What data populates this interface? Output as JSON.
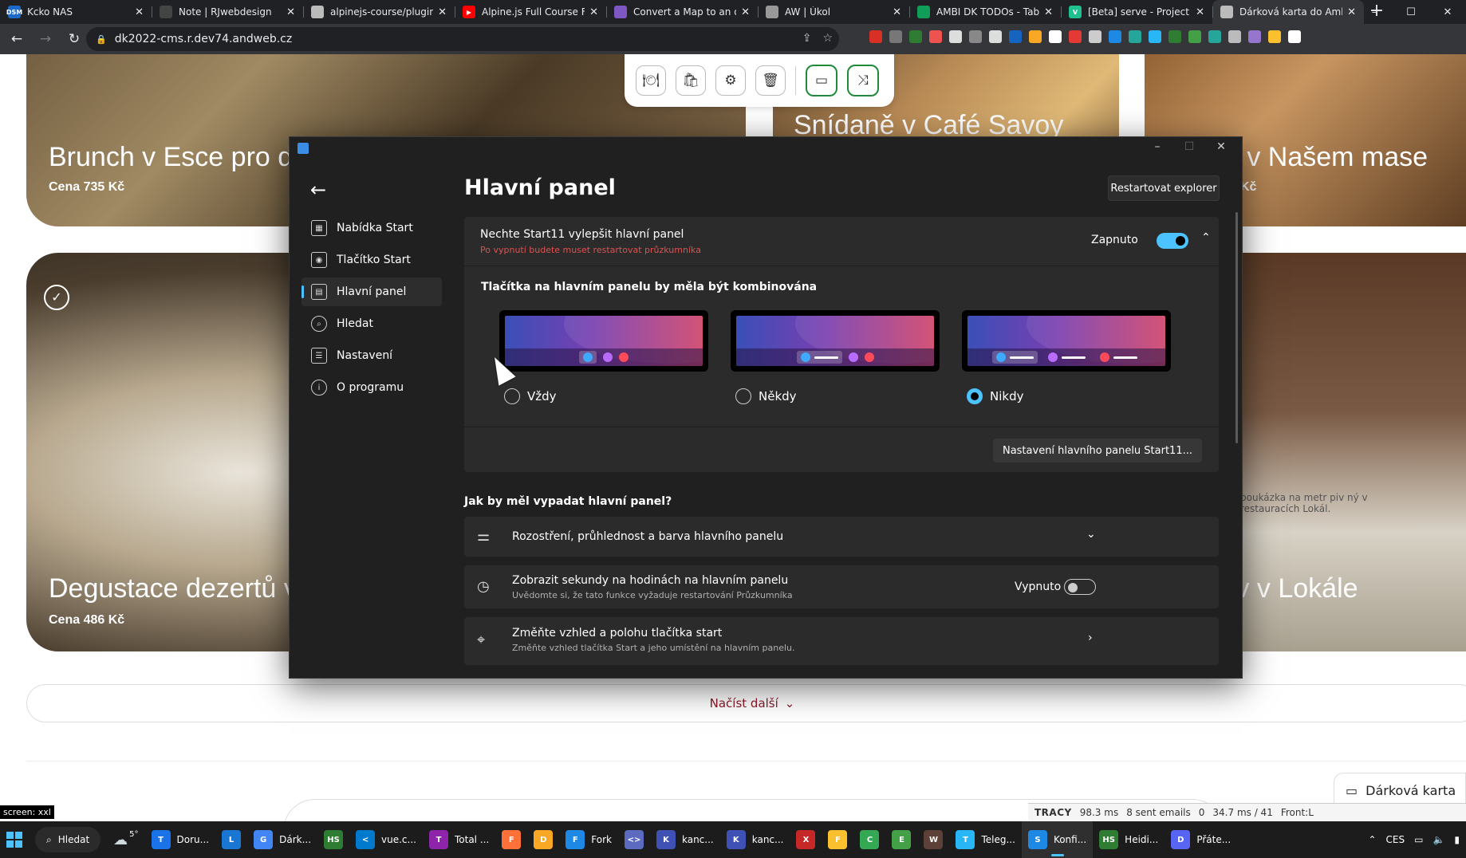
{
  "browser": {
    "tabs": [
      {
        "title": "Kcko NAS",
        "favicon_color": "#1e6ac8",
        "favicon_text": "DSM",
        "active": false
      },
      {
        "title": "Note | RJwebdesign",
        "favicon_color": "#444",
        "favicon_text": "",
        "active": false
      },
      {
        "title": "alpinejs-course/plugin",
        "favicon_color": "#fff",
        "favicon_text": "",
        "active": false
      },
      {
        "title": "Alpine.js Full Course F",
        "favicon_color": "#ff0000",
        "favicon_text": "▶",
        "active": false
      },
      {
        "title": "Convert a Map to an o",
        "favicon_color": "#7e57c2",
        "favicon_text": "",
        "active": false
      },
      {
        "title": "AW | Úkol",
        "favicon_color": "#999",
        "favicon_text": "",
        "active": false
      },
      {
        "title": "AMBI DK TODOs - Tab",
        "favicon_color": "#0f9d58",
        "favicon_text": "",
        "active": false
      },
      {
        "title": "[Beta] serve - Project t",
        "favicon_color": "#1fbf8f",
        "favicon_text": "V",
        "active": false
      },
      {
        "title": "Dárková karta do Amb",
        "favicon_color": "#fff",
        "favicon_text": "",
        "active": true
      }
    ],
    "new_tab": "+",
    "url": "dk2022-cms.r.dev74.andweb.cz",
    "extension_colors": [
      "#d93025",
      "#777",
      "#2e7d32",
      "#ef5350",
      "#ddd",
      "#888",
      "#ddd",
      "#1565c0",
      "#f9a825",
      "#fff",
      "#e53935",
      "#ccc",
      "#1e88e5",
      "#26a69a",
      "#29b6f6",
      "#2e7d32",
      "#43a047",
      "#26a69a",
      "#bbb",
      "#9575cd",
      "#fbc02d",
      "#fff"
    ]
  },
  "page": {
    "cards": [
      {
        "title": "Brunch v Esce pro d",
        "price": "Cena 735 Kč"
      },
      {
        "title": "Snídaně v Café Savoy",
        "price": ""
      },
      {
        "title": "o v Našem mase",
        "price": "Kč"
      },
      {
        "title": "Degustace dezertů v",
        "price": "Cena 486 Kč"
      },
      {
        "title": "piv v Lokále",
        "price": ""
      }
    ],
    "beer_sign": "poukázka na metr piv ný v restauracích Lokál.",
    "load_more": "Načíst další",
    "gift_card_button": "Dárková karta",
    "screen_label": "screen: xxl"
  },
  "tracy": {
    "label": "TRACY",
    "time": "98.3 ms",
    "emails": "8 sent emails",
    "count": "0",
    "db": "34.7 ms / 41",
    "front": "Front:L"
  },
  "dialog": {
    "heading": "Hlavní panel",
    "restart_explorer": "Restartovat explorer",
    "nav": [
      {
        "label": "Nabídka Start",
        "icon": "start-menu-icon",
        "selected": false
      },
      {
        "label": "Tlačítko Start",
        "icon": "start-button-icon",
        "selected": false
      },
      {
        "label": "Hlavní panel",
        "icon": "taskbar-icon",
        "selected": true
      },
      {
        "label": "Hledat",
        "icon": "search-icon",
        "selected": false
      },
      {
        "label": "Nastavení",
        "icon": "settings-icon",
        "selected": false
      },
      {
        "label": "O programu",
        "icon": "info-icon",
        "selected": false
      }
    ],
    "improve": {
      "title": "Nechte Start11 vylepšit hlavní panel",
      "subtitle": "Po vypnutí budete muset restartovat průzkumníka",
      "toggle_label": "Zapnuto",
      "toggle_on": true
    },
    "combine": {
      "title": "Tlačítka na hlavním panelu by měla být kombinována",
      "options": [
        {
          "label": "Vždy",
          "selected": false
        },
        {
          "label": "Někdy",
          "selected": false
        },
        {
          "label": "Nikdy",
          "selected": true
        }
      ],
      "settings_button": "Nastavení hlavního panelu Start11..."
    },
    "look_question": "Jak by měl vypadat hlavní panel?",
    "rows": [
      {
        "title": "Rozostření, průhlednost a barva hlavního panelu",
        "subtitle": ""
      },
      {
        "title": "Zobrazit sekundy na hodinách na hlavním panelu",
        "subtitle": "Uvědomte si, že tato funkce vyžaduje restartování Průzkumníka",
        "toggle_label": "Vypnuto",
        "toggle_on": false
      },
      {
        "title": "Změňte vzhled a polohu tlačítka start",
        "subtitle": "Změňte vzhled tlačítka Start a jeho umístění na hlavním panelu."
      }
    ]
  },
  "taskbar": {
    "search": "Hledat",
    "weather": "5°",
    "items": [
      {
        "label": "Doru...",
        "color": "#1a73e8",
        "icon": "T"
      },
      {
        "label": "",
        "color": "#1976d2",
        "icon": "L"
      },
      {
        "label": "Dárk...",
        "color": "#4285f4",
        "icon": "G"
      },
      {
        "label": "",
        "color": "#2e7d32",
        "icon": "HS"
      },
      {
        "label": "vue.c...",
        "color": "#007acc",
        "icon": "<"
      },
      {
        "label": "Total ...",
        "color": "#8e24aa",
        "icon": "T"
      },
      {
        "label": "",
        "color": "#ff7139",
        "icon": "F"
      },
      {
        "label": "",
        "color": "#f9a825",
        "icon": "D"
      },
      {
        "label": "Fork",
        "color": "#1e88e5",
        "icon": "F"
      },
      {
        "label": "",
        "color": "#5c6bc0",
        "icon": "<>"
      },
      {
        "label": "kanc...",
        "color": "#3f51b5",
        "icon": "K"
      },
      {
        "label": "kanc...",
        "color": "#3f51b5",
        "icon": "K"
      },
      {
        "label": "",
        "color": "#c62828",
        "icon": "X"
      },
      {
        "label": "",
        "color": "#fbc02d",
        "icon": "F"
      },
      {
        "label": "",
        "color": "#34a853",
        "icon": "C"
      },
      {
        "label": "",
        "color": "#43a047",
        "icon": "E"
      },
      {
        "label": "",
        "color": "#5d4037",
        "icon": "W"
      },
      {
        "label": "Teleg...",
        "color": "#29b6f6",
        "icon": "T"
      },
      {
        "label": "Konfi...",
        "color": "#1e88e5",
        "icon": "S"
      },
      {
        "label": "Heidi...",
        "color": "#2e7d32",
        "icon": "HS"
      },
      {
        "label": "Přáte...",
        "color": "#5865f2",
        "icon": "D"
      }
    ],
    "lang": "CES"
  }
}
